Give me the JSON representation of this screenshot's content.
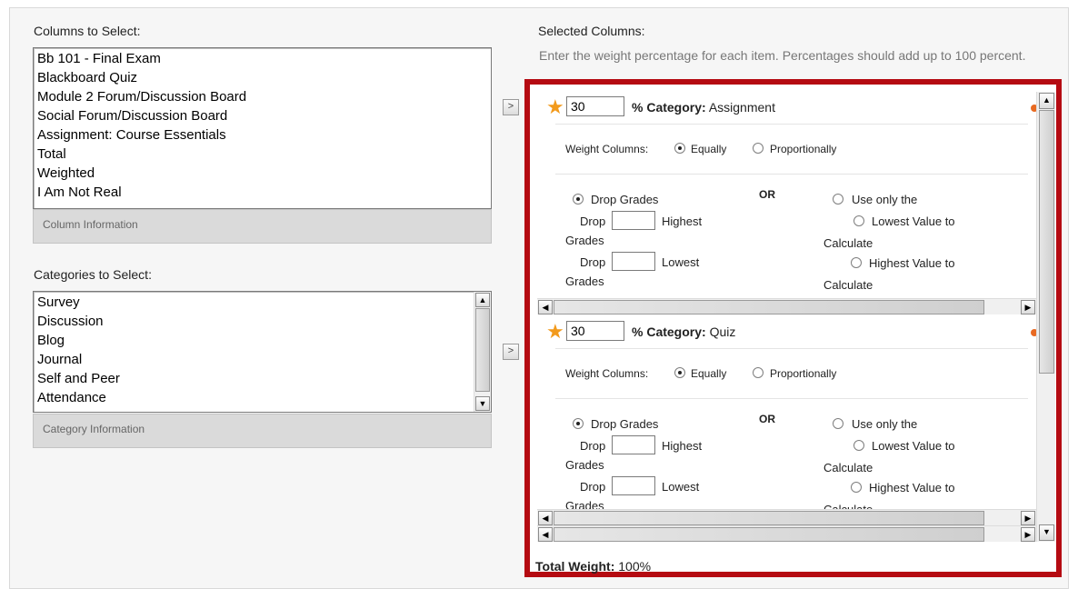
{
  "columns_panel": {
    "title": "Columns to Select:",
    "items": [
      "Bb 101 - Final Exam",
      "Blackboard Quiz",
      "Module 2 Forum/Discussion Board",
      "Social Forum/Discussion Board",
      "Assignment: Course Essentials",
      "Total",
      "Weighted",
      "I Am Not Real"
    ],
    "info_label": "Column Information",
    "move_button": ">"
  },
  "categories_panel": {
    "title": "Categories to Select:",
    "items": [
      "Survey",
      "Discussion",
      "Blog",
      "Journal",
      "Self and Peer",
      "Attendance"
    ],
    "info_label": "Category Information",
    "move_button": ">"
  },
  "selected_panel": {
    "title": "Selected Columns:",
    "instructions": "Enter the weight percentage for each item. Percentages should add up to 100 percent.",
    "categories": [
      {
        "weight": "30",
        "pct_label": "% Category:",
        "name": "Assignment",
        "weight_columns_label": "Weight Columns:",
        "equally_label": "Equally",
        "proportionally_label": "Proportionally",
        "drop_grades_label": "Drop Grades",
        "or_label": "OR",
        "use_only_label": "Use only the",
        "drop_label": "Drop",
        "highest_label": "Highest",
        "lowest_label": "Lowest",
        "grades_label": "Grades",
        "lowest_value_label": "Lowest Value to",
        "highest_value_label": "Highest Value to",
        "calculate_label": "Calculate"
      },
      {
        "weight": "30",
        "pct_label": "% Category:",
        "name": "Quiz",
        "weight_columns_label": "Weight Columns:",
        "equally_label": "Equally",
        "proportionally_label": "Proportionally",
        "drop_grades_label": "Drop Grades",
        "or_label": "OR",
        "use_only_label": "Use only the",
        "drop_label": "Drop",
        "highest_label": "Highest",
        "lowest_label": "Lowest",
        "grades_label": "Grades",
        "lowest_value_label": "Lowest Value to",
        "highest_value_label": "Highest Value to",
        "calculate_label": "Calculate"
      }
    ],
    "total_label": "Total Weight:",
    "total_value": "100%"
  },
  "colors": {
    "highlight_border": "#b50b12",
    "required_star": "#f29a1c"
  }
}
